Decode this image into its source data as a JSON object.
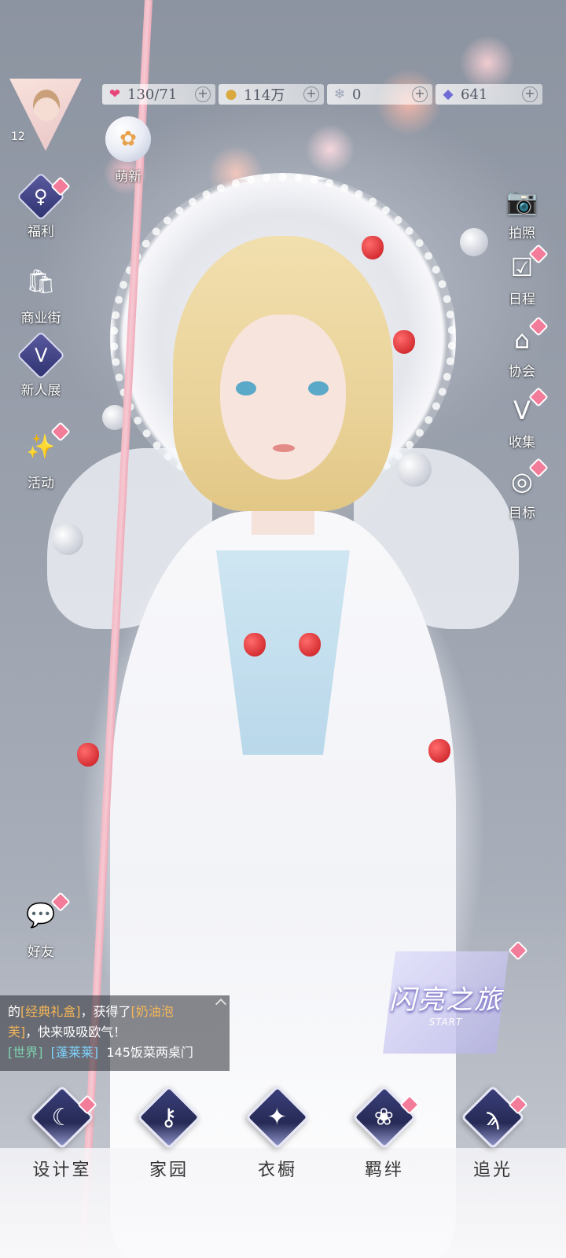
{
  "hud": {
    "level": "12",
    "resources": [
      {
        "icon": "heart-gem-icon",
        "glyph": "❤",
        "color": "#e8457a",
        "value": "130/71"
      },
      {
        "icon": "gold-coin-icon",
        "glyph": "●",
        "color": "#d9a93e",
        "value": "114万"
      },
      {
        "icon": "crystal-icon",
        "glyph": "❄",
        "color": "#9aa3b5",
        "value": "0"
      },
      {
        "icon": "diamond-icon",
        "glyph": "◆",
        "color": "#6f6ad6",
        "value": "641"
      }
    ],
    "plus_symbol": "+"
  },
  "mengxin": {
    "label": "萌新"
  },
  "left_menu": {
    "fuli": "福利",
    "shangyejie": "商业街",
    "xinrenzhan": "新人展",
    "huodong": "活动",
    "haoyou": "好友"
  },
  "right_menu": {
    "paizhao": "拍照",
    "richeng": "日程",
    "xiehui": "协会",
    "shouji": "收集",
    "mubiao": "目标"
  },
  "chat": {
    "line1_prefix": "的",
    "item1": "[经典礼盒]",
    "line1_mid": "，获得了",
    "item2": "[奶油泡",
    "item2b": "芙]",
    "line2_suffix": "，快来吸吸欧气！",
    "channel": "[世界]",
    "name": "[蓬莱莱]",
    "message": "145饭菜两桌门"
  },
  "start_badge": {
    "title": "闪亮之旅",
    "subtitle": "START"
  },
  "bottom_nav": {
    "design": "设计室",
    "home": "家园",
    "wardrobe": "衣橱",
    "bond": "羁绊",
    "chase": "追光"
  },
  "colors": {
    "badge": "#f37c9a",
    "accent": "#3a3f7a"
  }
}
